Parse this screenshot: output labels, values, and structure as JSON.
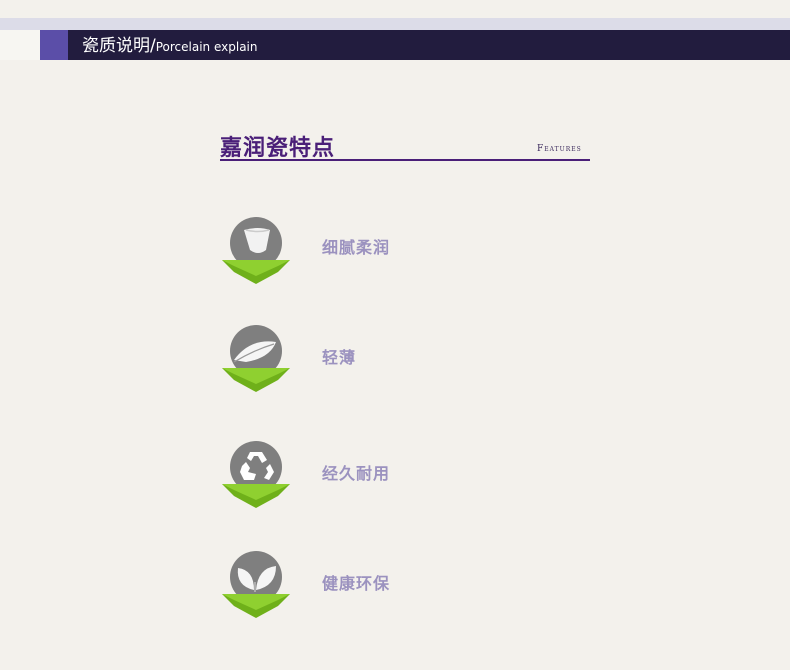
{
  "header": {
    "title_cn": "瓷质说明/",
    "title_en": "Porcelain explain"
  },
  "section": {
    "title": "嘉润瓷特点",
    "subtitle": "Features"
  },
  "features": [
    {
      "label": "细腻柔润",
      "icon": "cup-icon"
    },
    {
      "label": "轻薄",
      "icon": "feather-icon"
    },
    {
      "label": "经久耐用",
      "icon": "recycle-icon"
    },
    {
      "label": "健康环保",
      "icon": "leaf-icon"
    }
  ],
  "colors": {
    "header_bg": "#221c3e",
    "header_accent": "#5b4ea8",
    "title_purple": "#4a1f78",
    "label_lavender": "#9b92bf",
    "badge_grey": "#808080",
    "badge_green": "#7cc020"
  }
}
